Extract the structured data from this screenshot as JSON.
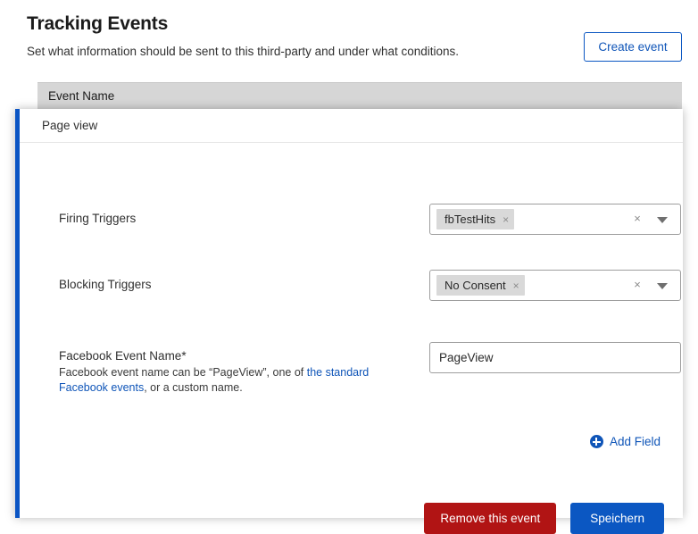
{
  "page": {
    "title": "Tracking Events",
    "subtitle": "Set what information should be sent to this third-party and under what conditions.",
    "create_event_label": "Create event"
  },
  "table": {
    "column_header_event_name": "Event Name"
  },
  "event_panel": {
    "header_title": "Page view",
    "accent_color": "#0b55c4",
    "fields": {
      "firing_triggers": {
        "label": "Firing Triggers",
        "chip_label": "fbTestHits",
        "chip_remove_icon": "×",
        "clear_icon": "×",
        "caret_icon": "chevron-down"
      },
      "blocking_triggers": {
        "label": "Blocking Triggers",
        "chip_label": "No Consent",
        "chip_remove_icon": "×",
        "clear_icon": "×",
        "caret_icon": "chevron-down"
      },
      "facebook_event_name": {
        "label": "Facebook Event Name*",
        "help_prefix": "Facebook event name can be “PageView”, one of ",
        "help_link": "the standard Facebook events",
        "help_suffix": ", or a custom name.",
        "value": "PageView",
        "placeholder": ""
      }
    },
    "add_field_label": "Add Field",
    "add_field_icon": "plus-circle-icon",
    "remove_event_label": "Remove this event",
    "save_label": "Speichern",
    "remove_color": "#b11414",
    "save_color": "#0b57c2"
  }
}
